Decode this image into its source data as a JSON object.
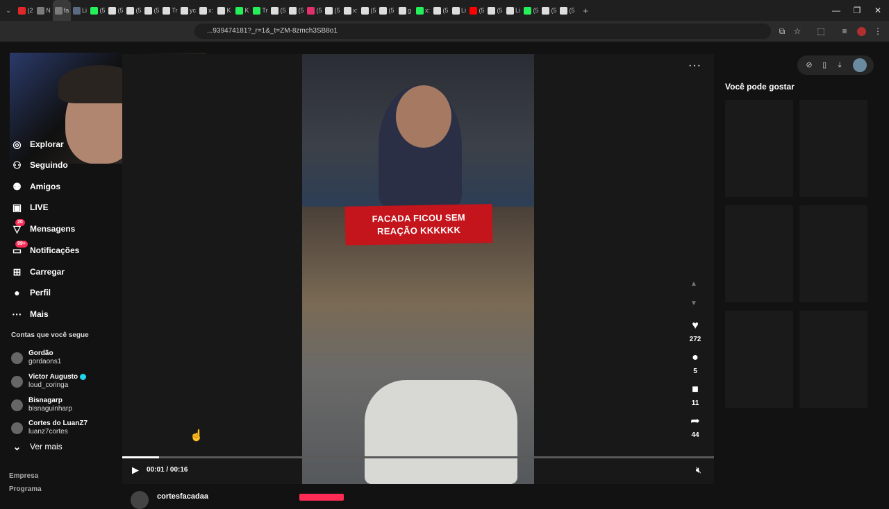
{
  "browser": {
    "url": "...939474181?_r=1&_t=ZM-8zmch3SB8o1",
    "tab_favicons": [
      "#e02828",
      "#7b7b7b",
      "#7b7b7b",
      "#5a6a80",
      "#25f05a",
      "#ddd",
      "#ddd",
      "#ddd",
      "#ddd",
      "#ddd",
      "#ddd",
      "#ddd",
      "#25f05a",
      "#25f05a",
      "#ddd",
      "#ddd",
      "#e1306c",
      "#ddd",
      "#ddd",
      "#ddd",
      "#ddd",
      "#ddd",
      "#25f05a",
      "#ddd",
      "#ddd",
      "#ff0000",
      "#ddd",
      "#ddd",
      "#25f05a",
      "#ddd",
      "#ddd"
    ],
    "tab_labels": [
      "(2",
      "N",
      "fa",
      "Li",
      "(5",
      "(5",
      "(5",
      "(5",
      "Tr",
      "yc",
      "x:",
      "K",
      "K",
      "Tr",
      "(5",
      "(5",
      "(5",
      "(5",
      "x:",
      "(5",
      "(5",
      "g",
      "x:",
      "(5",
      "Li",
      "(5",
      "(5",
      "Li",
      "(5",
      "(5",
      "(5"
    ],
    "new_tab": "+",
    "window": {
      "minimize": "—",
      "restore": "❐",
      "close": "✕"
    }
  },
  "sidebar": {
    "items": [
      {
        "label": "Explorar",
        "icon": "compass-icon",
        "glyph": "◎",
        "badge": ""
      },
      {
        "label": "Seguindo",
        "icon": "following-icon",
        "glyph": "⚇",
        "badge": ""
      },
      {
        "label": "Amigos",
        "icon": "friends-icon",
        "glyph": "⚉",
        "badge": ""
      },
      {
        "label": "LIVE",
        "icon": "live-icon",
        "glyph": "▣",
        "badge": ""
      },
      {
        "label": "Mensagens",
        "icon": "messages-icon",
        "glyph": "▽",
        "badge": "20"
      },
      {
        "label": "Notificações",
        "icon": "inbox-icon",
        "glyph": "▭",
        "badge": "99+"
      },
      {
        "label": "Carregar",
        "icon": "upload-icon",
        "glyph": "⊞",
        "badge": ""
      },
      {
        "label": "Perfil",
        "icon": "profile-avatar-icon",
        "glyph": "●",
        "badge": ""
      },
      {
        "label": "Mais",
        "icon": "more-dots-icon",
        "glyph": "···",
        "badge": ""
      }
    ],
    "following_title": "Contas que você segue",
    "accounts": [
      {
        "name": "Gordão",
        "handle": "gordaons1",
        "verified": false
      },
      {
        "name": "Victor Augusto",
        "handle": "loud_coringa",
        "verified": true
      },
      {
        "name": "Bisnagarp",
        "handle": "bisnaguinharp",
        "verified": false
      },
      {
        "name": "Cortes do LuanZ7",
        "handle": "luanz7cortes",
        "verified": false
      }
    ],
    "see_more": "Ver mais",
    "footer": [
      "Empresa",
      "Programa"
    ]
  },
  "video": {
    "caption_line1": "FACADA FICOU SEM",
    "caption_line2": "REAÇÃO KKKKKK",
    "likes": "272",
    "comments": "5",
    "saves": "11",
    "shares": "44",
    "time": "00:01 / 00:16",
    "progress": 0.0625,
    "author": "cortesfacadaa",
    "more": "···"
  },
  "right": {
    "title": "Você pode gostar",
    "thumb_count": 6
  },
  "colors": {
    "accent": "#fe2c55",
    "caption_red": "#c4141c",
    "verified": "#20d5ec"
  }
}
